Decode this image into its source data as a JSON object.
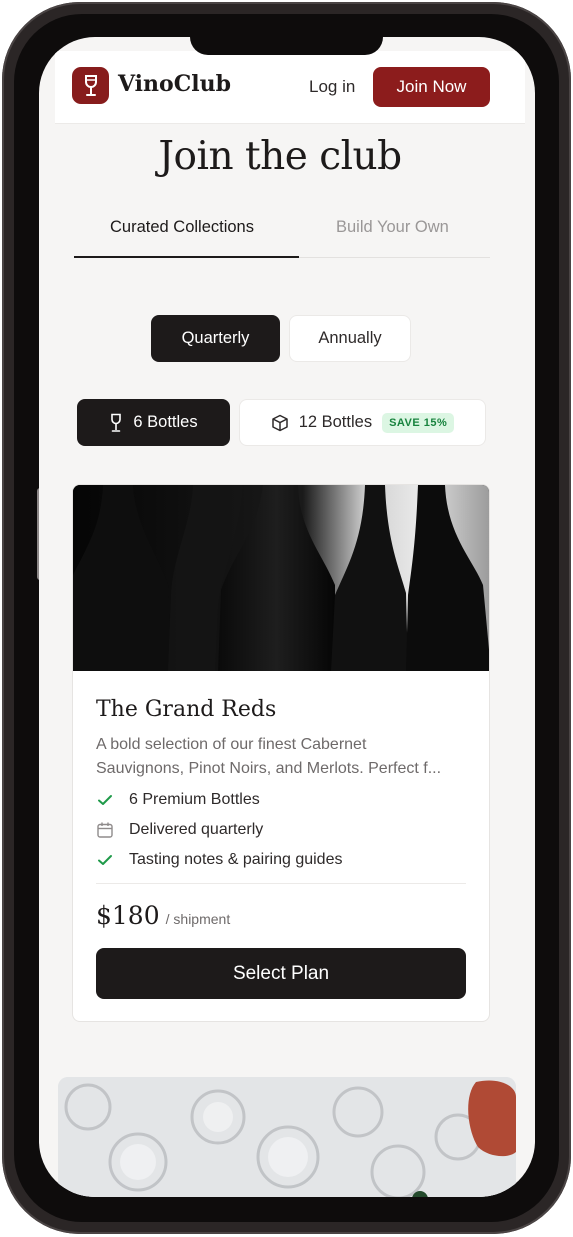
{
  "app": {
    "name": "VinoClub",
    "login_label": "Log in",
    "join_label": "Join Now",
    "accent_color": "#8c1c1c"
  },
  "page": {
    "title": "Join the club"
  },
  "tabs": [
    {
      "label": "Curated Collections",
      "active": true
    },
    {
      "label": "Build Your Own",
      "active": false
    }
  ],
  "frequency": {
    "options": [
      "Quarterly",
      "Annually"
    ],
    "selected": "Quarterly"
  },
  "bottles": {
    "options": [
      {
        "label": "6 Bottles",
        "icon": "wine-glass-icon",
        "selected": true
      },
      {
        "label": "12 Bottles",
        "icon": "box-icon",
        "selected": false,
        "badge": "SAVE 15%"
      }
    ]
  },
  "plan": {
    "name": "The Grand Reds",
    "description_line1": "A bold selection of our finest Cabernet",
    "description_line2": "Sauvignons, Pinot Noirs, and Merlots. Perfect f...",
    "features": [
      {
        "icon": "check-icon",
        "text": "6 Premium Bottles"
      },
      {
        "icon": "calendar-icon",
        "text": "Delivered quarterly"
      },
      {
        "icon": "check-icon",
        "text": "Tasting notes & pairing guides"
      }
    ],
    "price": "$180",
    "price_unit": "/ shipment",
    "cta": "Select Plan"
  }
}
